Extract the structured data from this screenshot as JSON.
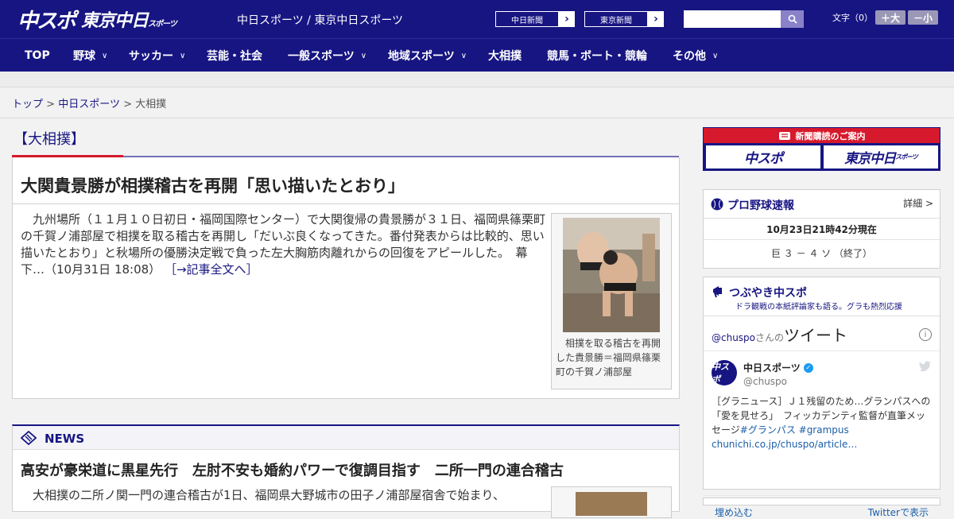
{
  "header": {
    "logo_main": "中スポ",
    "logo_sub": "東京中日",
    "logo_sub_small": "スポーツ",
    "site_title": "中日スポーツ / 東京中日スポーツ",
    "paper_links": [
      "中日新聞",
      "東京新聞"
    ],
    "search_placeholder": "",
    "font_size_label": "文字（0）",
    "font_up": "＋大",
    "font_down": "－小"
  },
  "nav": [
    {
      "label": "TOP",
      "dropdown": false
    },
    {
      "label": "野球",
      "dropdown": true
    },
    {
      "label": "サッカー",
      "dropdown": true
    },
    {
      "label": "芸能・社会",
      "dropdown": false
    },
    {
      "label": "一般スポーツ",
      "dropdown": true
    },
    {
      "label": "地域スポーツ",
      "dropdown": true
    },
    {
      "label": "大相撲",
      "dropdown": false
    },
    {
      "label": "競馬・ボート・競輪",
      "dropdown": false
    },
    {
      "label": "その他",
      "dropdown": true
    }
  ],
  "breadcrumb": {
    "top": "トップ",
    "sep": ">",
    "parent": "中日スポーツ",
    "current": "大相撲"
  },
  "section": {
    "title": "【大相撲】"
  },
  "article": {
    "headline": "大関貴景勝が相撲稽古を再開「思い描いたとおり」",
    "body": "九州場所（１１月１０日初日・福岡国際センター）で大関復帰の貴景勝が３１日、福岡県篠栗町の千賀ノ浦部屋で相撲を取る稽古を再開し「だいぶ良くなってきた。番付発表からは比較的、思い描いたとおり」と秋場所の優勝決定戦で負った左大胸筋肉離れからの回復をアピールした。　幕下…（10月31日 18:08）",
    "more_link": "［→記事全文へ］",
    "photo_caption": "相撲を取る稽古を再開した貴景勝＝福岡県篠栗町の千賀ノ浦部屋"
  },
  "news": {
    "label": "NEWS",
    "headline": "高安が豪栄道に黒星先行　左肘不安も婚約パワーで復調目指す　二所一門の連合稽古",
    "body": "大相撲の二所ノ関一門の連合稽古が1日、福岡県大野城市の田子ノ浦部屋宿舎で始まり、"
  },
  "sidebar": {
    "subscribe": {
      "label": "新聞購読のご案内",
      "card1": "中スポ",
      "card2": "東京中日",
      "card2_small": "スポーツ"
    },
    "baseball": {
      "title": "プロ野球速報",
      "detail": "詳細 >",
      "time": "10月23日21時42分現在",
      "score": "巨 ３ － ４ ソ （終了）"
    },
    "tweets": {
      "title": "つぶやき中スポ",
      "subtitle": "ドラ観戦の本紙評論家も語る。グラも熱烈応援",
      "header_handle": "@chuspo",
      "header_san": "さんの",
      "header_big": "ツイート",
      "info": "i",
      "account_name": "中日スポーツ",
      "account_handle": "@chuspo",
      "avatar_text": "中スポ",
      "tweet_text": "［グラニュース］Ｊ１残留のため…グランパスへの「愛を見せろ」　フィッカデンティ監督が直筆メッセージ",
      "tweet_tags": "#グランパス #grampus",
      "tweet_link": "chunichi.co.jp/chuspo/article…",
      "embed_label": "埋め込む",
      "view_label": "Twitterで表示"
    }
  },
  "colors": {
    "brand": "#171582",
    "accent_red": "#d6192c",
    "link_blue": "#1b5ea8"
  }
}
